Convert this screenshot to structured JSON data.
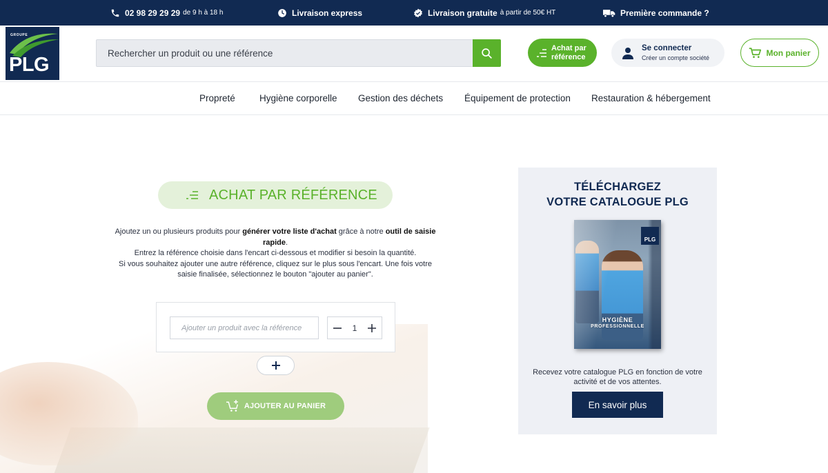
{
  "topbar": {
    "phone": "02 98 29 29 29",
    "phone_hours": "de 9 h à 18 h",
    "express": "Livraison express",
    "free_delivery": "Livraison gratuite",
    "free_delivery_note": "à partir de 50€ HT",
    "first_order": "Première commande ?"
  },
  "header": {
    "logo_groupe": "GROUPE",
    "logo_text": "PLG",
    "search_placeholder": "Rechercher un produit ou une référence",
    "ref_button": "Achat par référence",
    "login_title": "Se connecter",
    "login_sub": "Créer un compte société",
    "cart_label": "Mon panier"
  },
  "nav": {
    "items": [
      "Propreté",
      "Hygiène corporelle",
      "Gestion des déchets",
      "Équipement de protection",
      "Restauration & hébergement"
    ]
  },
  "main": {
    "title": "ACHAT PAR RÉFÉRENCE",
    "intro_1a": "Ajoutez un ou plusieurs produits pour ",
    "intro_1b": "générer votre liste d'achat",
    "intro_1c": " grâce à notre ",
    "intro_1d": "outil de saisie rapide",
    "intro_1e": ".",
    "intro_2": "Entrez la référence choisie dans l'encart ci-dessous et modifier si besoin la quantité.",
    "intro_3": "Si vous souhaitez ajouter une autre référence, cliquez sur le plus sous l'encart. Une fois votre saisie finalisée, sélectionnez le bouton \"ajouter au panier\".",
    "ref_placeholder": "Ajouter un produit avec la référence",
    "quantity": "1",
    "add_to_cart": "AJOUTER AU PANIER"
  },
  "catalogue": {
    "title_1": "TÉLÉCHARGEZ",
    "title_2": "VOTRE CATALOGUE PLG",
    "cover_logo": "PLG",
    "cover_title_1": "HYGIÈNE",
    "cover_title_2": "PROFESSIONNELLE",
    "description": "Recevez votre catalogue PLG en fonction de votre activité et de vos attentes.",
    "button": "En savoir plus"
  },
  "colors": {
    "navy": "#112a52",
    "green": "#5ab22b",
    "green_light": "#9fcc7d"
  }
}
